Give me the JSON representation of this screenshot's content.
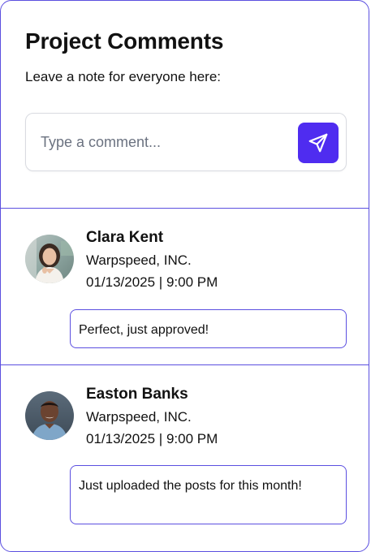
{
  "header": {
    "title": "Project Comments",
    "subtitle": "Leave a note for everyone here:"
  },
  "composer": {
    "placeholder": "Type a comment...",
    "value": "",
    "send_icon": "send-icon",
    "accent_color": "#4f2cf0"
  },
  "comments": [
    {
      "name": "Clara Kent",
      "company": "Warpspeed, INC.",
      "timestamp": "01/13/2025 | 9:00 PM",
      "text": "Perfect, just approved!"
    },
    {
      "name": "Easton Banks",
      "company": "Warpspeed, INC.",
      "timestamp": "01/13/2025 | 9:00 PM",
      "text": "Just uploaded the posts for this month!"
    }
  ],
  "colors": {
    "border": "#5b4fe0",
    "accent": "#4f2cf0"
  }
}
